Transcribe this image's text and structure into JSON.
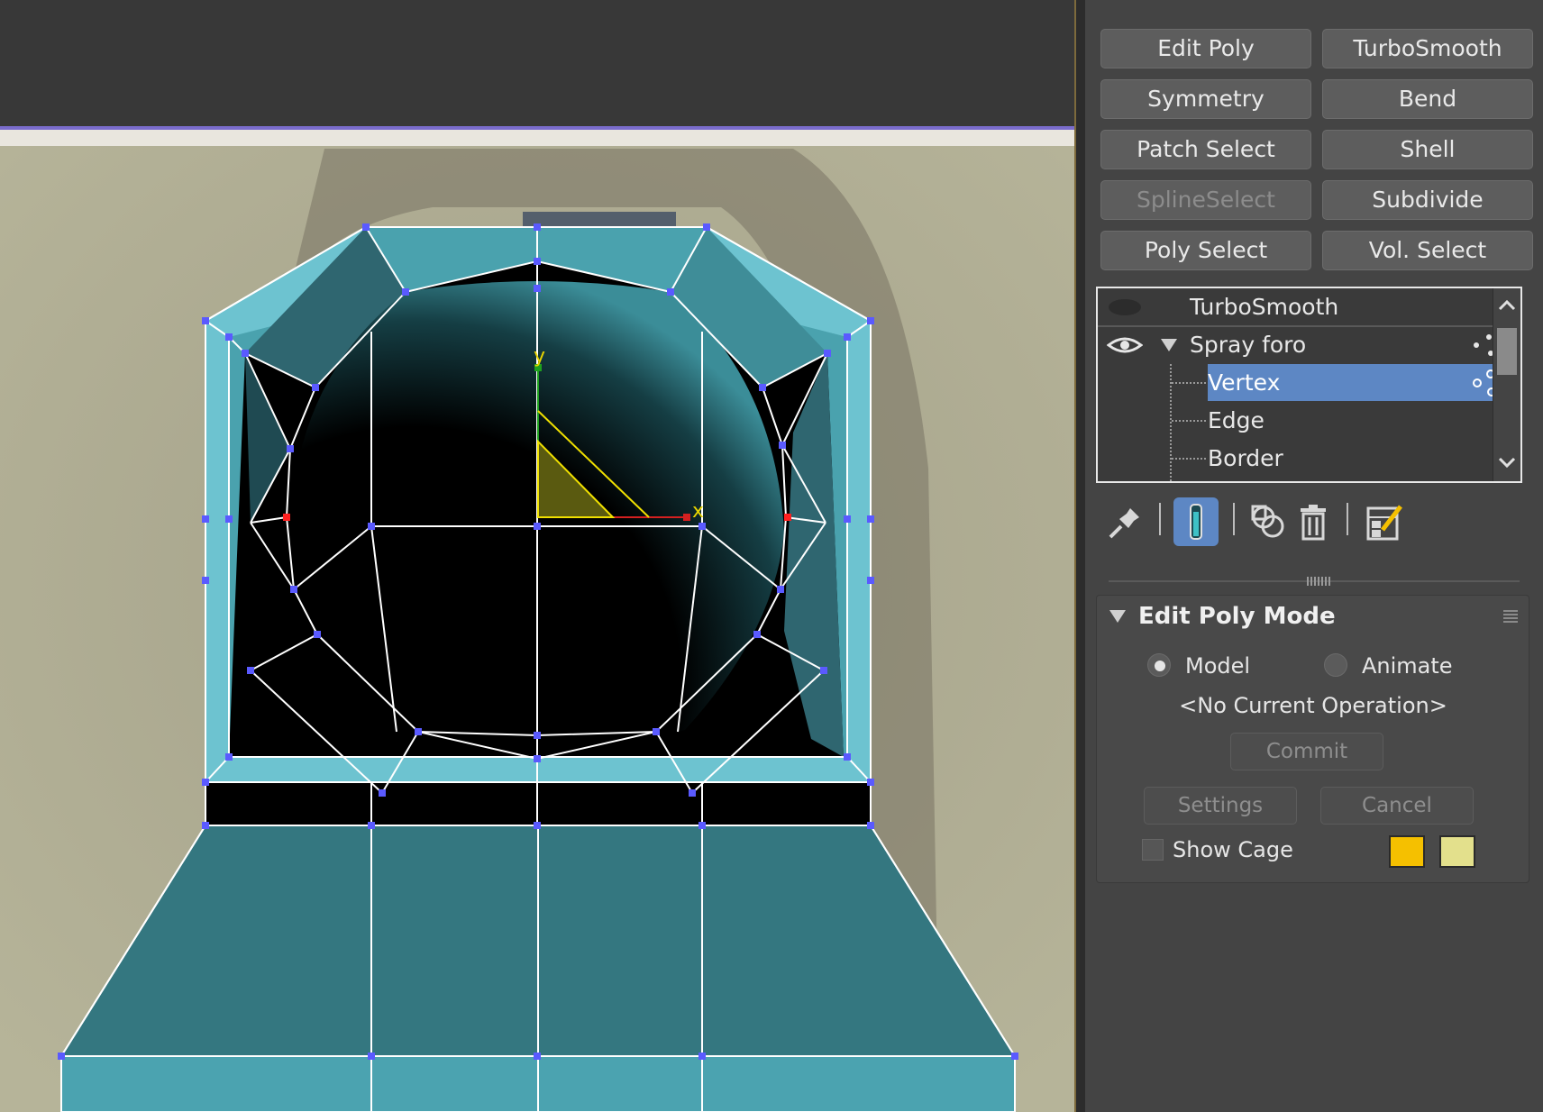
{
  "modifier_buttons": [
    {
      "label": "Edit Poly",
      "enabled": true
    },
    {
      "label": "TurboSmooth",
      "enabled": true
    },
    {
      "label": "Symmetry",
      "enabled": true
    },
    {
      "label": "Bend",
      "enabled": true
    },
    {
      "label": "Patch Select",
      "enabled": true
    },
    {
      "label": "Shell",
      "enabled": true
    },
    {
      "label": "SplineSelect",
      "enabled": false
    },
    {
      "label": "Subdivide",
      "enabled": true
    },
    {
      "label": "Poly Select",
      "enabled": true
    },
    {
      "label": "Vol. Select",
      "enabled": true
    }
  ],
  "stack": {
    "items": [
      {
        "label": "TurboSmooth",
        "visible": false
      },
      {
        "label": "Spray foro",
        "visible": true,
        "expanded": true
      },
      {
        "label": "Vertex",
        "selected": true
      },
      {
        "label": "Edge"
      },
      {
        "label": "Border"
      }
    ]
  },
  "toolbar": {
    "icons": [
      "pin-stack-icon",
      "show-end-result-icon",
      "make-unique-icon",
      "remove-modifier-icon",
      "configure-modifier-sets-icon"
    ],
    "active": "show-end-result-icon"
  },
  "rollout": {
    "title": "Edit Poly Mode",
    "mode_model": "Model",
    "mode_animate": "Animate",
    "mode_selected": "Model",
    "current_operation": "<No Current Operation>",
    "commit_label": "Commit",
    "settings_label": "Settings",
    "cancel_label": "Cancel",
    "show_cage_label": "Show Cage",
    "show_cage_checked": false,
    "cage_color_1": "#f5c000",
    "cage_color_2": "#e3e08c"
  },
  "viewport": {
    "gizmo_x": "x",
    "gizmo_y": "y"
  }
}
